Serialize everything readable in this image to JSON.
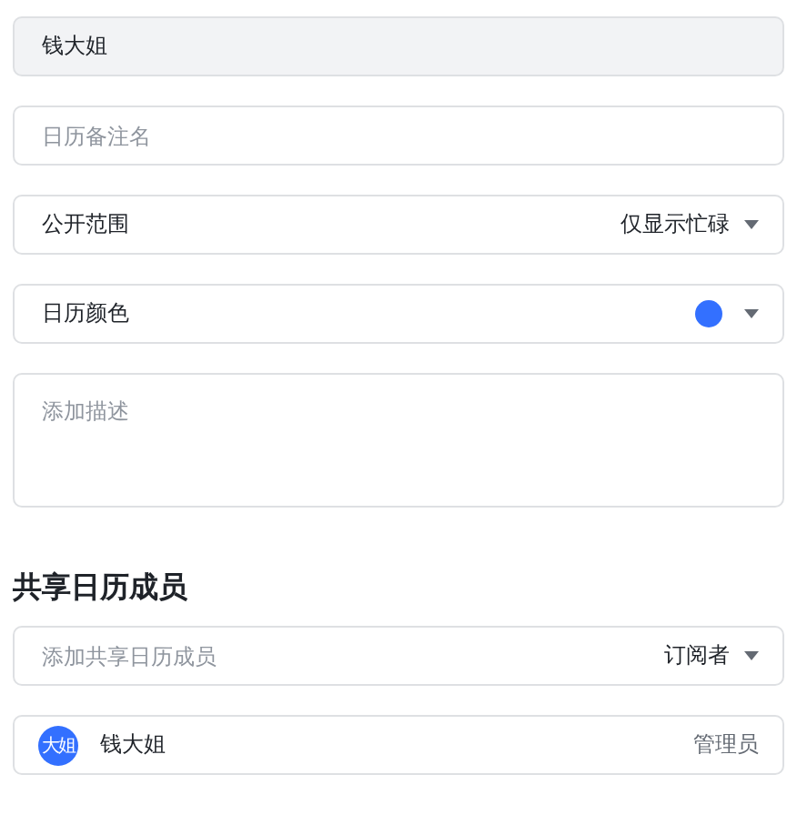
{
  "name_field": {
    "value": "钱大姐",
    "disabled": true
  },
  "remark_field": {
    "placeholder": "日历备注名"
  },
  "visibility": {
    "label": "公开范围",
    "value": "仅显示忙碌"
  },
  "calendar_color": {
    "label": "日历颜色",
    "color": "#3370ff"
  },
  "description": {
    "placeholder": "添加描述"
  },
  "members_section": {
    "title": "共享日历成员",
    "add_field": {
      "placeholder": "添加共享日历成员",
      "role": "订阅者"
    },
    "members": [
      {
        "avatar": "大姐",
        "name": "钱大姐",
        "role": "管理员"
      }
    ]
  }
}
